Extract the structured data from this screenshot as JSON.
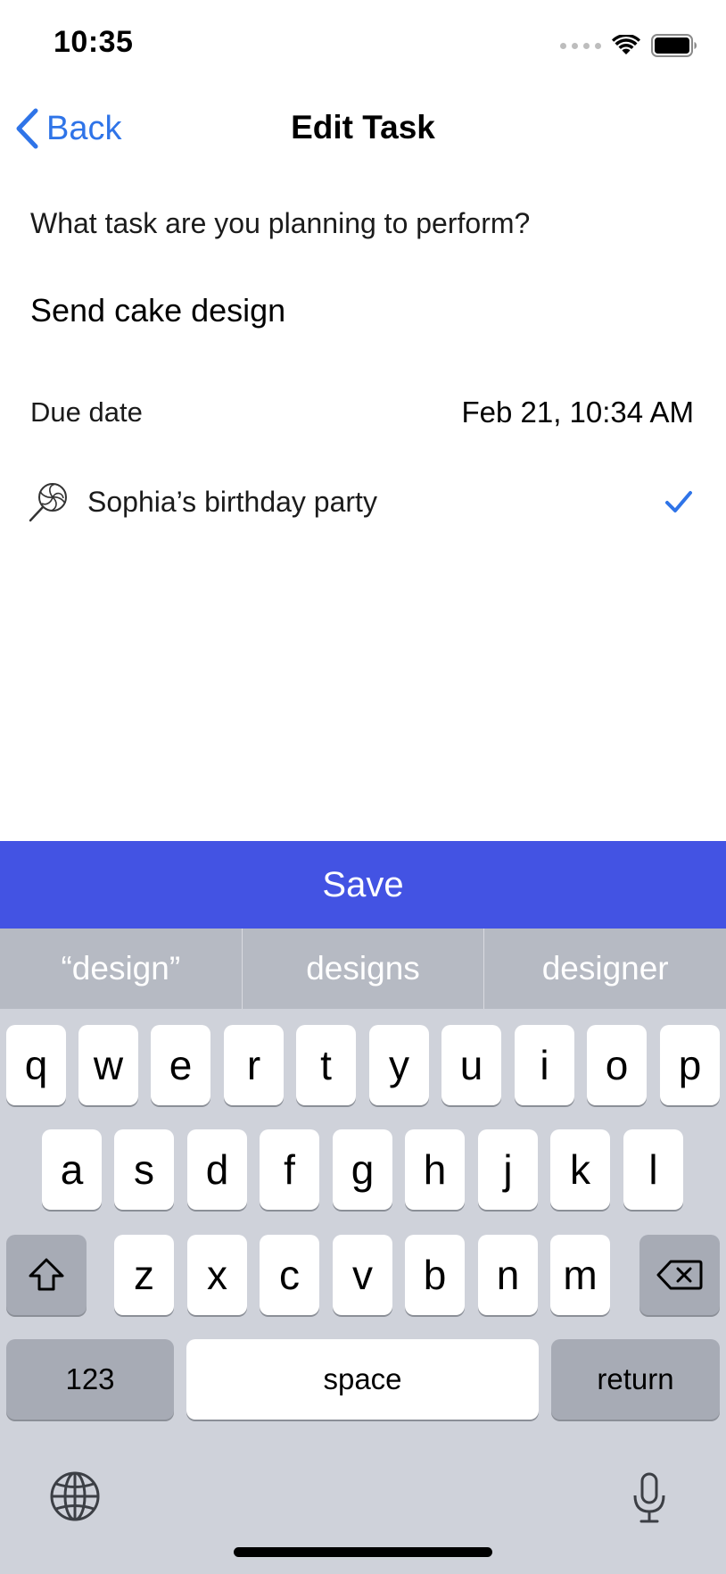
{
  "status_bar": {
    "time": "10:35"
  },
  "nav": {
    "back_label": "Back",
    "title": "Edit Task"
  },
  "form": {
    "question": "What task are you planning to perform?",
    "task_value": "Send cake design",
    "due_label": "Due date",
    "due_value": "Feb 21, 10:34 AM",
    "event_label": "Sophia’s birthday party",
    "event_icon": "lollipop-icon",
    "event_selected": true
  },
  "save_label": "Save",
  "colors": {
    "accent": "#2f74e8",
    "save_bg": "#4353e3"
  },
  "keyboard": {
    "suggestions": [
      "“design”",
      "designs",
      "designer"
    ],
    "row1": [
      "q",
      "w",
      "e",
      "r",
      "t",
      "y",
      "u",
      "i",
      "o",
      "p"
    ],
    "row2": [
      "a",
      "s",
      "d",
      "f",
      "g",
      "h",
      "j",
      "k",
      "l"
    ],
    "row3": [
      "z",
      "x",
      "c",
      "v",
      "b",
      "n",
      "m"
    ],
    "numbers_label": "123",
    "space_label": "space",
    "return_label": "return"
  }
}
